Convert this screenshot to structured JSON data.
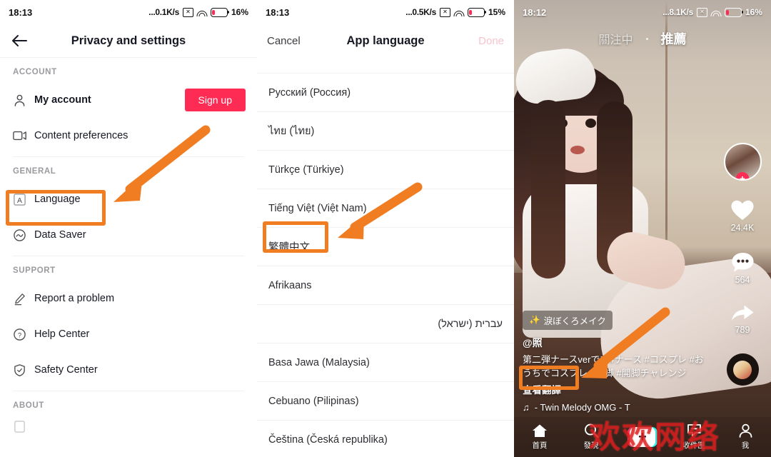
{
  "panels": {
    "settings": {
      "statusbar": {
        "time": "18:13",
        "speed": "...0.1K/s",
        "battery": "16%"
      },
      "nav": {
        "back_icon": "back-arrow-icon",
        "title": "Privacy and settings"
      },
      "sections": [
        {
          "header": "ACCOUNT",
          "items": [
            {
              "icon": "person-icon",
              "label": "My account",
              "bold": true,
              "action": "Sign up"
            },
            {
              "icon": "video-camera-icon",
              "label": "Content preferences",
              "bold": false
            }
          ]
        },
        {
          "header": "GENERAL",
          "items": [
            {
              "icon": "letter-a-icon",
              "label": "Language",
              "bold": false
            },
            {
              "icon": "data-saver-icon",
              "label": "Data Saver",
              "bold": false
            }
          ]
        },
        {
          "header": "SUPPORT",
          "items": [
            {
              "icon": "pencil-icon",
              "label": "Report a problem",
              "bold": false
            },
            {
              "icon": "question-circle-icon",
              "label": "Help Center",
              "bold": false
            },
            {
              "icon": "shield-check-icon",
              "label": "Safety Center",
              "bold": false
            }
          ]
        },
        {
          "header": "ABOUT",
          "items": []
        }
      ]
    },
    "language": {
      "statusbar": {
        "time": "18:13",
        "speed": "...0.5K/s",
        "battery": "15%"
      },
      "nav": {
        "cancel": "Cancel",
        "title": "App language",
        "done": "Done"
      },
      "languages": [
        "Русский (Россия)",
        "ไทย (ไทย)",
        "Türkçe (Türkiye)",
        "Tiếng Việt (Việt Nam)",
        "繁體中文",
        "Afrikaans",
        "עברית (ישראל)",
        "Basa Jawa (Malaysia)",
        "Cebuano (Pilipinas)",
        "Čeština (Česká republika)"
      ],
      "selected_language": "繁體中文"
    },
    "video": {
      "statusbar": {
        "time": "18:12",
        "speed": "...8.1K/s",
        "battery": "16%"
      },
      "topbar": {
        "following": "關注中",
        "for_you": "推薦",
        "active": "推薦"
      },
      "rail": {
        "avatar": "user-avatar",
        "follow": "+",
        "like_count": "24.4K",
        "comment_count": "564",
        "share_count": "789",
        "disc": "music-disc"
      },
      "caption": {
        "effect": "淚ぼくろメイク",
        "handle": "@照",
        "description": "第二弾ナースverです#ナース #コスプレ #おうちでコスプレ #開脚 #開脚チャレンジ",
        "translate": "查看翻譯",
        "music": "- Twin Melody   OMG - T"
      },
      "tabbar": [
        {
          "icon": "home-icon",
          "label": "首頁"
        },
        {
          "icon": "search-icon",
          "label": "發現"
        },
        {
          "icon": "add-icon",
          "label": ""
        },
        {
          "icon": "inbox-icon",
          "label": "收件匣"
        },
        {
          "icon": "profile-icon",
          "label": "我"
        }
      ],
      "watermark": "欢欢网络"
    }
  },
  "annotations": {
    "accent_color": "#F07D22",
    "highlights": [
      "Language",
      "繁體中文",
      "查看翻譯"
    ]
  },
  "colors": {
    "brand_red": "#FE2C55",
    "annotation_orange": "#F07D22",
    "text": "#161823"
  }
}
